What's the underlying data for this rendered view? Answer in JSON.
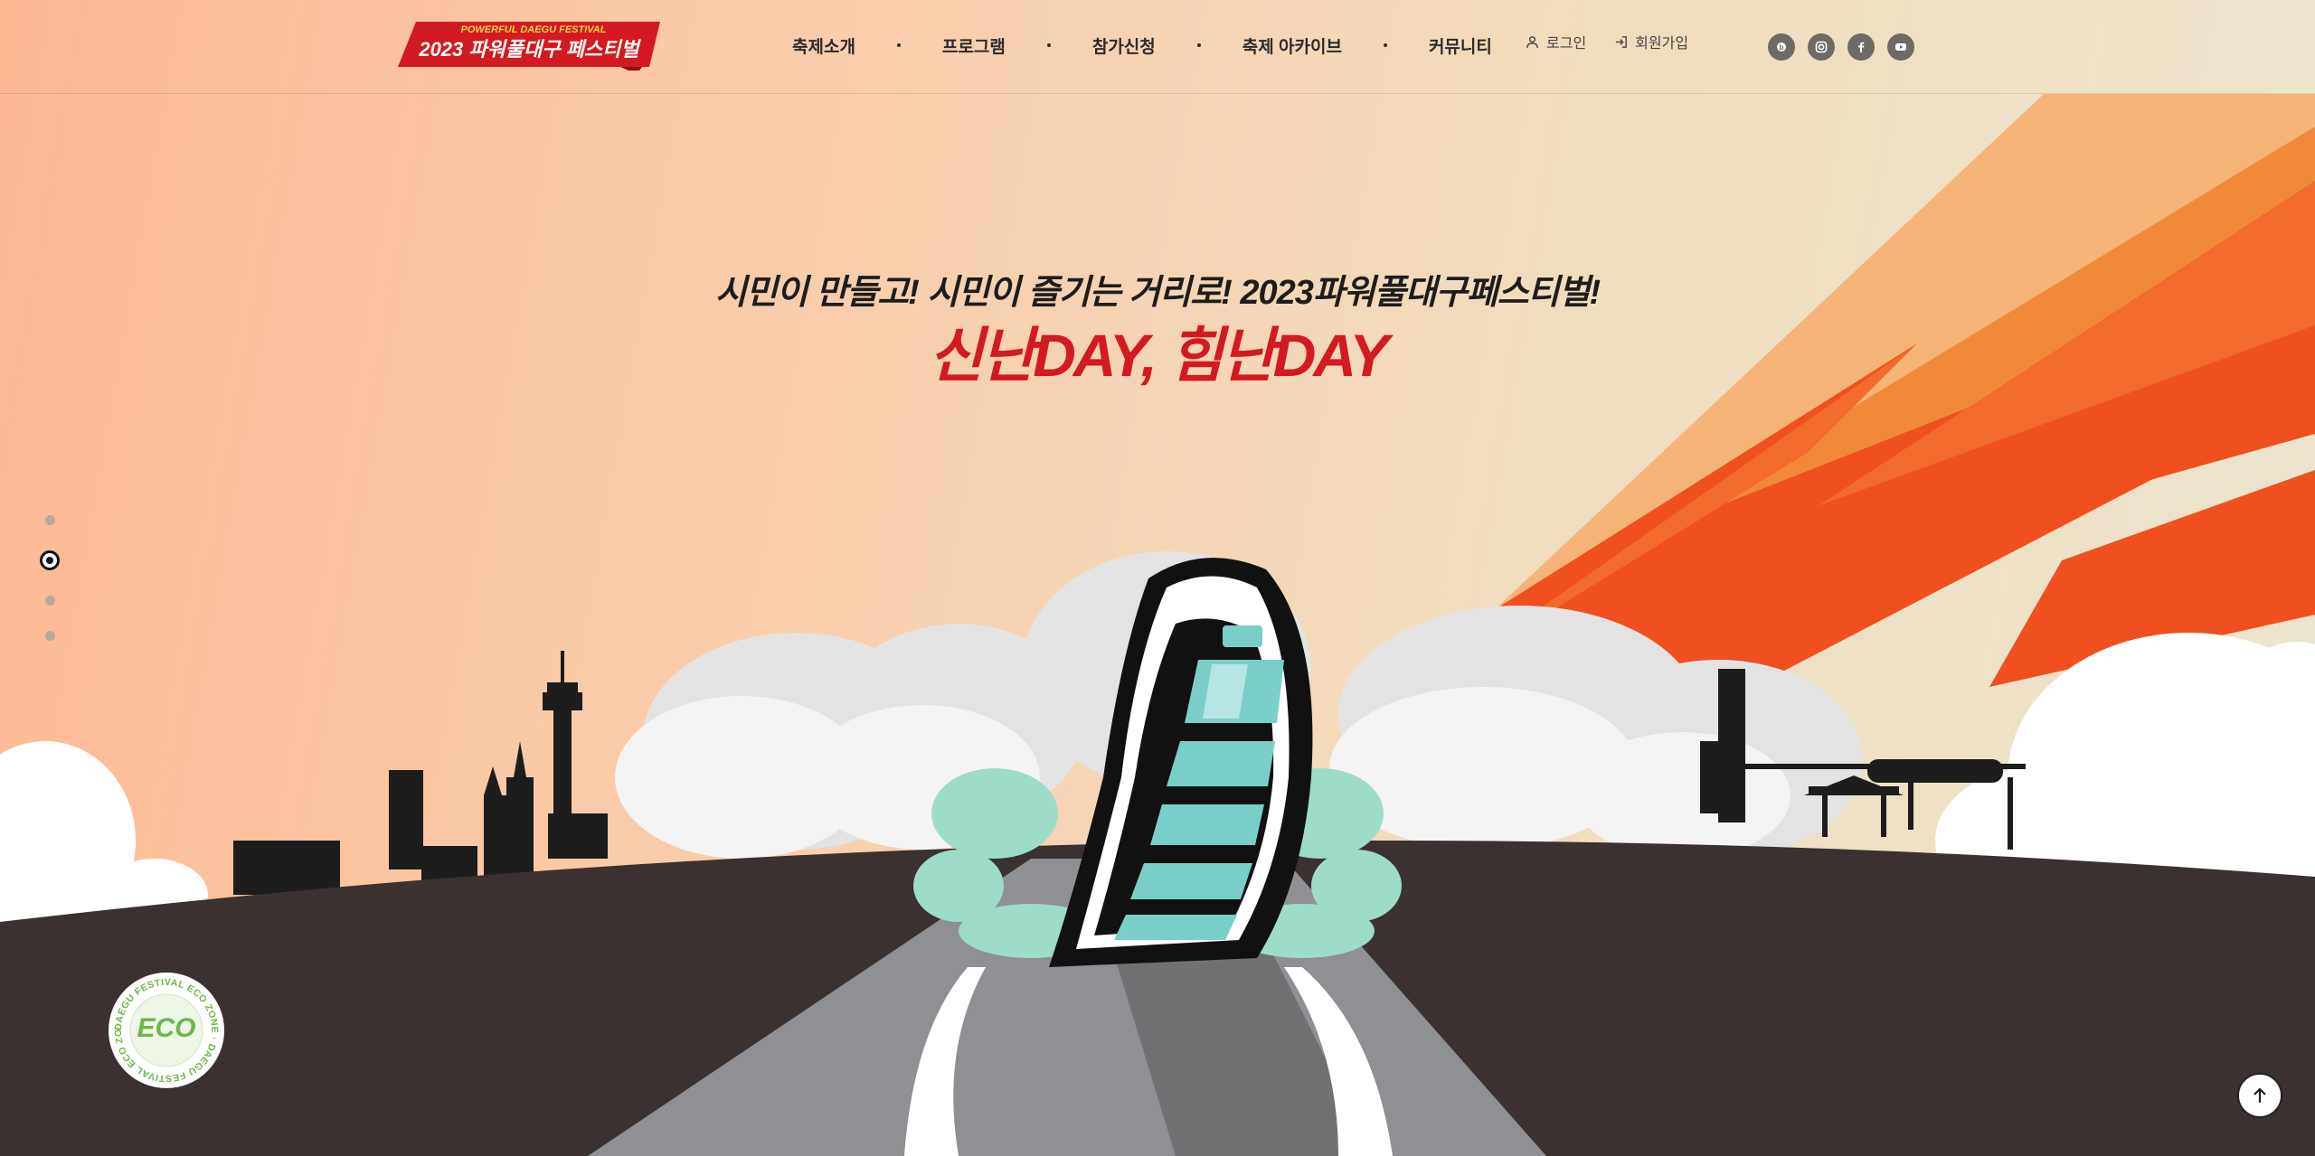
{
  "header": {
    "logo_small": "POWERFUL DAEGU FESTIVAL",
    "logo_main": "2023 파워풀대구 페스티벌",
    "nav": [
      "축제소개",
      "프로그램",
      "참가신청",
      "축제 아카이브",
      "커뮤니티"
    ],
    "login_label": "로그인",
    "join_label": "회원가입",
    "sns": [
      "blog-icon",
      "instagram-icon",
      "facebook-icon",
      "youtube-icon"
    ]
  },
  "hero": {
    "subtitle": "시민이 만들고! 시민이 즐기는 거리로! 2023파워풀대구페스티벌!",
    "title": "신난DAY, 힘난DAY"
  },
  "pager": {
    "count": 4,
    "active_index": 1
  },
  "eco_badge": {
    "label": "ECO",
    "ring_text": "DAEGU FESTIVAL ECO ZONE · DAEGU FESTIVAL ECO ZONE ·"
  },
  "colors": {
    "accent_red": "#d31a20",
    "ground": "#3a3130",
    "road": "#8e9093",
    "sky_orange": "#f04f20",
    "eco_green": "#6cb64a"
  }
}
